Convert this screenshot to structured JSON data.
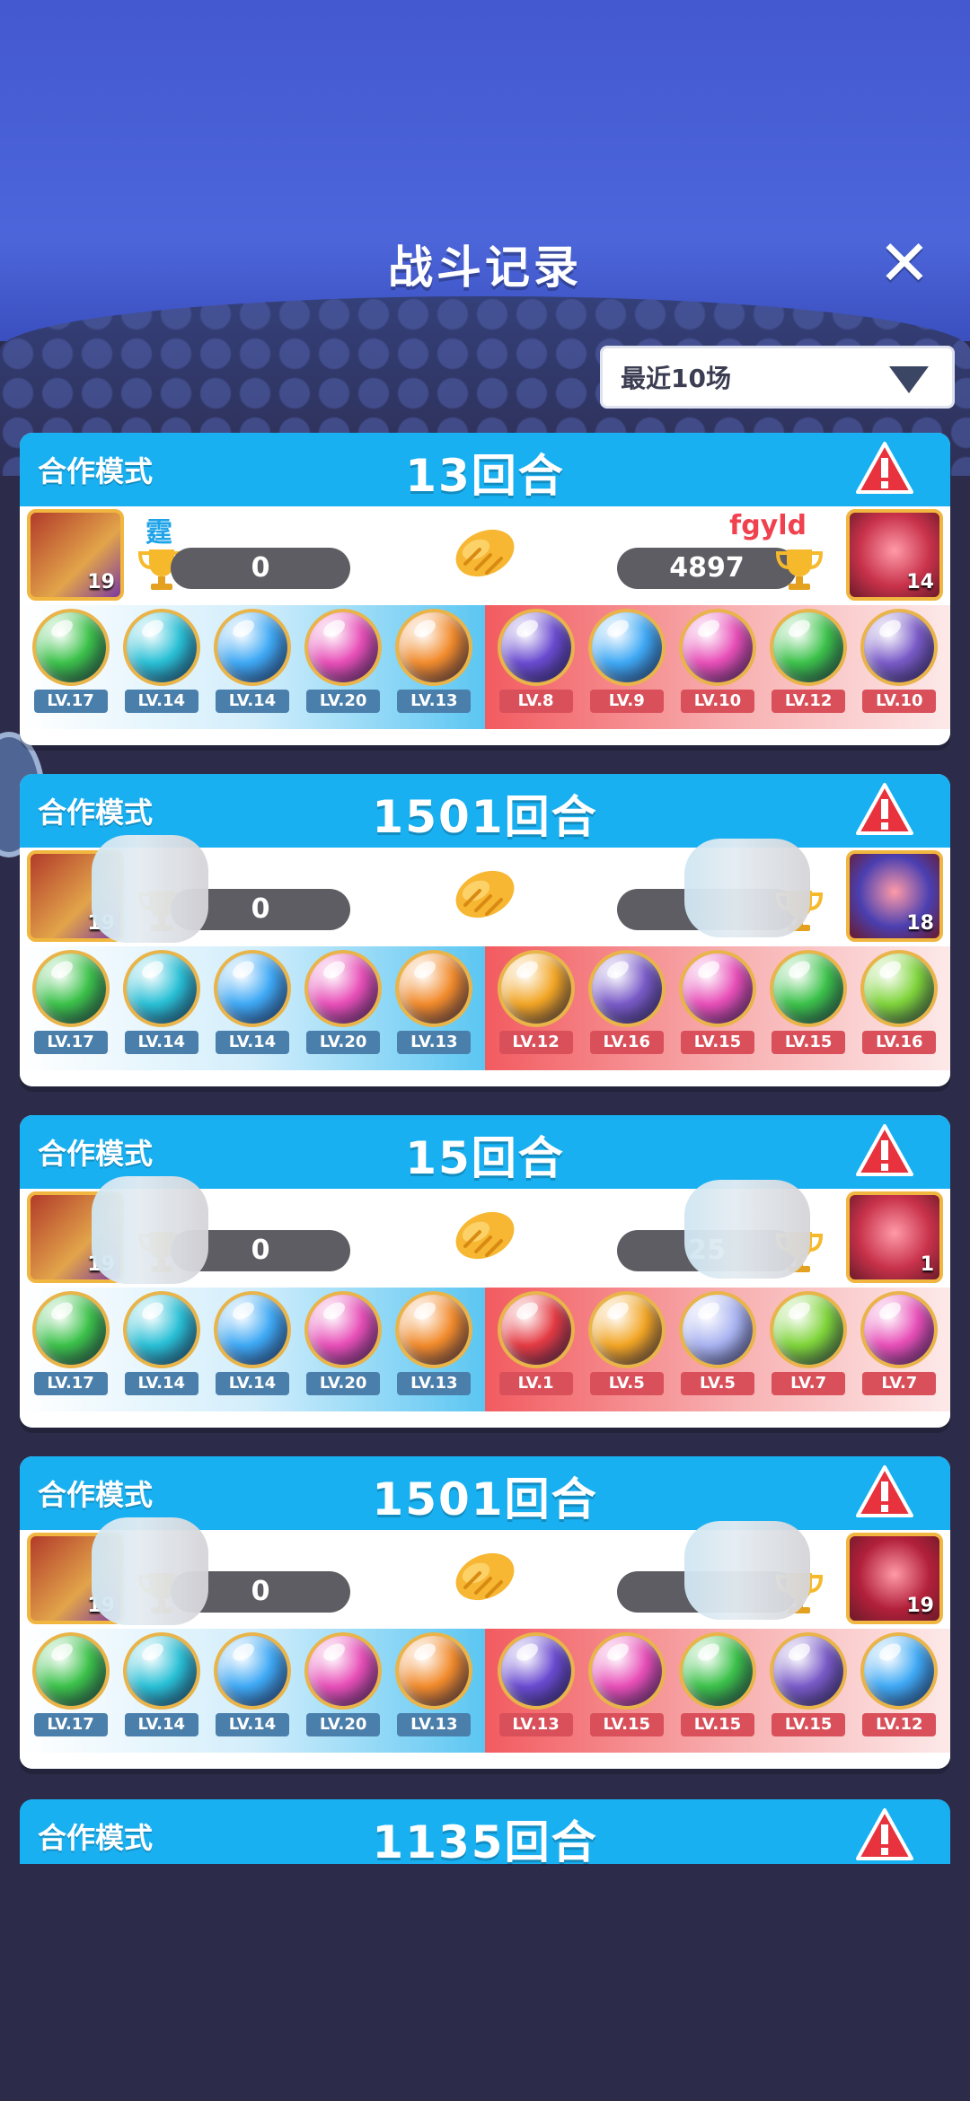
{
  "header": {
    "title": "战斗记录",
    "close_icon": "close-icon"
  },
  "filter": {
    "label": "最近10场"
  },
  "colors": {
    "blue": "#3fa9f5",
    "green": "#3cc24a",
    "pink": "#e84fb8",
    "orange": "#f28b2c",
    "purple": "#6a4bd1",
    "violet": "#7a5bc8",
    "teal": "#29c0d6",
    "red": "#e53b43",
    "gold": "#f2a524",
    "lilac": "#a9b3f0",
    "lime": "#7fd43a"
  },
  "matches": [
    {
      "mode": "合作模式",
      "rounds": "13回合",
      "left": {
        "name": "霆",
        "score": "0",
        "avatar_level": "19"
      },
      "right": {
        "name": "fgyld",
        "score": "4897",
        "avatar_level": "14",
        "avatar_color": "#c8324a"
      },
      "left_cards": [
        {
          "color": "green",
          "level": "LV.17"
        },
        {
          "color": "teal",
          "level": "LV.14"
        },
        {
          "color": "blue",
          "level": "LV.14"
        },
        {
          "color": "pink",
          "level": "LV.20"
        },
        {
          "color": "orange",
          "level": "LV.13"
        }
      ],
      "right_cards": [
        {
          "color": "purple",
          "level": "LV.8"
        },
        {
          "color": "blue",
          "level": "LV.9"
        },
        {
          "color": "pink",
          "level": "LV.10"
        },
        {
          "color": "green",
          "level": "LV.12"
        },
        {
          "color": "violet",
          "level": "LV.10"
        }
      ]
    },
    {
      "mode": "合作模式",
      "rounds": "1501回合",
      "left": {
        "name": "",
        "score": "0",
        "avatar_level": "19"
      },
      "right": {
        "name": "",
        "score": "",
        "avatar_level": "18",
        "avatar_color": "#4a3fb0"
      },
      "left_cards": [
        {
          "color": "green",
          "level": "LV.17"
        },
        {
          "color": "teal",
          "level": "LV.14"
        },
        {
          "color": "blue",
          "level": "LV.14"
        },
        {
          "color": "pink",
          "level": "LV.20"
        },
        {
          "color": "orange",
          "level": "LV.13"
        }
      ],
      "right_cards": [
        {
          "color": "gold",
          "level": "LV.12"
        },
        {
          "color": "violet",
          "level": "LV.16"
        },
        {
          "color": "pink",
          "level": "LV.15"
        },
        {
          "color": "green",
          "level": "LV.15"
        },
        {
          "color": "lime",
          "level": "LV.16"
        }
      ]
    },
    {
      "mode": "合作模式",
      "rounds": "15回合",
      "left": {
        "name": "",
        "score": "0",
        "avatar_level": "19"
      },
      "right": {
        "name": "",
        "score": "25",
        "avatar_level": "1",
        "avatar_color": "#c8324a"
      },
      "left_cards": [
        {
          "color": "green",
          "level": "LV.17"
        },
        {
          "color": "teal",
          "level": "LV.14"
        },
        {
          "color": "blue",
          "level": "LV.14"
        },
        {
          "color": "pink",
          "level": "LV.20"
        },
        {
          "color": "orange",
          "level": "LV.13"
        }
      ],
      "right_cards": [
        {
          "color": "red",
          "level": "LV.1"
        },
        {
          "color": "gold",
          "level": "LV.5"
        },
        {
          "color": "lilac",
          "level": "LV.5"
        },
        {
          "color": "lime",
          "level": "LV.7"
        },
        {
          "color": "pink",
          "level": "LV.7"
        }
      ]
    },
    {
      "mode": "合作模式",
      "rounds": "1501回合",
      "left": {
        "name": "",
        "score": "0",
        "avatar_level": "19"
      },
      "right": {
        "name": "",
        "score": "",
        "avatar_level": "19",
        "avatar_color": "#b2203a"
      },
      "left_cards": [
        {
          "color": "green",
          "level": "LV.17"
        },
        {
          "color": "teal",
          "level": "LV.14"
        },
        {
          "color": "blue",
          "level": "LV.14"
        },
        {
          "color": "pink",
          "level": "LV.20"
        },
        {
          "color": "orange",
          "level": "LV.13"
        }
      ],
      "right_cards": [
        {
          "color": "purple",
          "level": "LV.13"
        },
        {
          "color": "pink",
          "level": "LV.15"
        },
        {
          "color": "green",
          "level": "LV.15"
        },
        {
          "color": "violet",
          "level": "LV.15"
        },
        {
          "color": "blue",
          "level": "LV.12"
        }
      ]
    }
  ],
  "partial_match": {
    "mode": "合作模式",
    "rounds": "1135回合"
  }
}
